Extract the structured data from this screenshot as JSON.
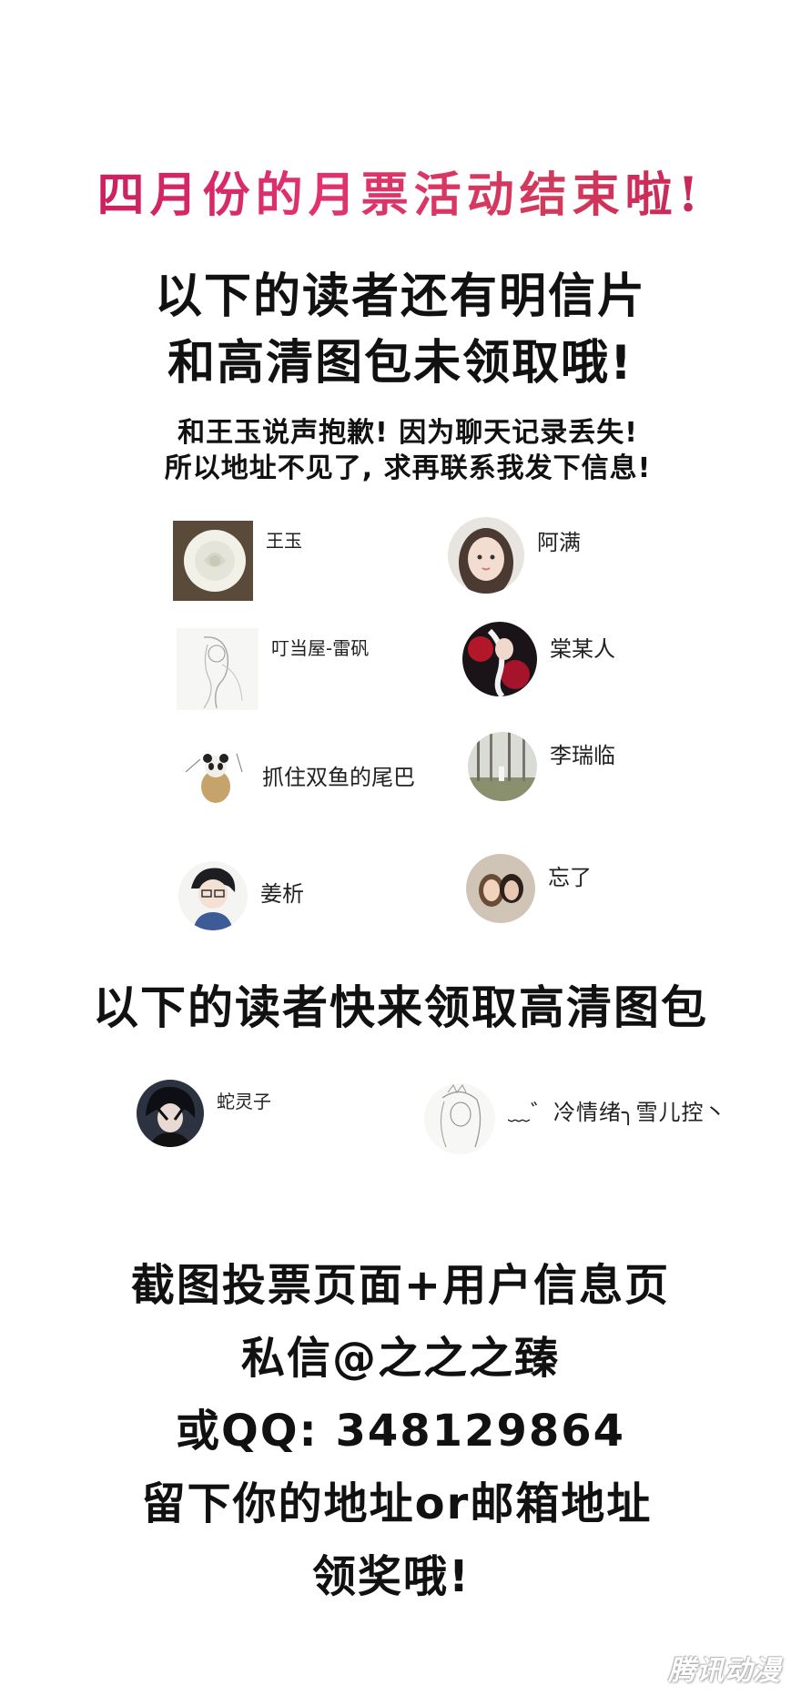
{
  "header": {
    "title": "四月份的月票活动结束啦!",
    "line1": "以下的读者还有明信片",
    "line2": "和高清图包未领取哦!",
    "note1": "和王玉说声抱歉! 因为聊天记录丢失!",
    "note2": "所以地址不见了, 求再联系我发下信息!"
  },
  "group1": {
    "users": [
      {
        "name": "王玉",
        "avatar_icon": "white-rose-avatar-icon"
      },
      {
        "name": "阿满",
        "avatar_icon": "girl-portrait-avatar-icon"
      },
      {
        "name": "叮当屋-雷矾",
        "avatar_icon": "sketch-figure-avatar-icon"
      },
      {
        "name": "棠某人",
        "avatar_icon": "anime-red-black-avatar-icon"
      },
      {
        "name": "抓住双鱼的尾巴",
        "avatar_icon": "panda-avatar-icon"
      },
      {
        "name": "李瑞临",
        "avatar_icon": "trees-avatar-icon"
      },
      {
        "name": "姜析",
        "avatar_icon": "anime-boy-avatar-icon"
      },
      {
        "name": "忘了",
        "avatar_icon": "couple-avatar-icon"
      }
    ]
  },
  "section2": {
    "heading": "以下的读者快来领取高清图包",
    "users": [
      {
        "name": "蛇灵子",
        "avatar_icon": "dark-hair-boy-avatar-icon"
      },
      {
        "name": "﹏゛冷情绪╮雪儿控丶",
        "avatar_icon": "sketch-girl-avatar-icon"
      }
    ]
  },
  "footer": {
    "line1": "截图投票页面+用户信息页",
    "line2": "私信@之之之臻",
    "line3": "或QQ: 348129864",
    "line4": "留下你的地址or邮箱地址",
    "line5": "领奖哦!"
  },
  "watermark": "腾讯动漫",
  "colors": {
    "title_accent": "#d0245f",
    "text": "#111111",
    "background": "#ffffff"
  }
}
